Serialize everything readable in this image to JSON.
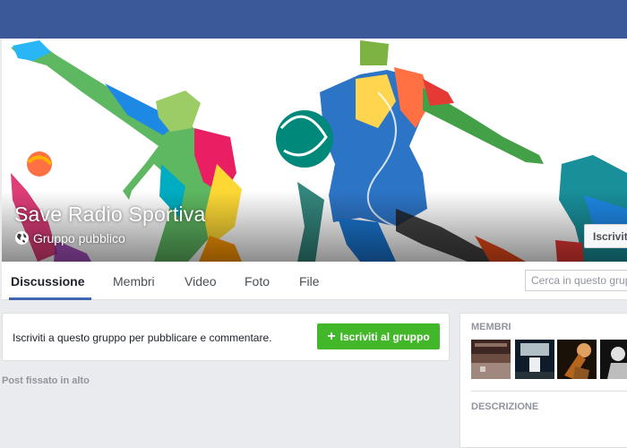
{
  "group": {
    "name": "Save Radio Sportiva",
    "privacy": "Gruppo pubblico",
    "cover_join_label": "Iscriviti"
  },
  "tabs": [
    {
      "label": "Discussione",
      "active": true
    },
    {
      "label": "Membri",
      "active": false
    },
    {
      "label": "Video",
      "active": false
    },
    {
      "label": "Foto",
      "active": false
    },
    {
      "label": "File",
      "active": false
    }
  ],
  "search": {
    "placeholder": "Cerca in questo gruppo"
  },
  "join_card": {
    "text": "Iscriviti a questo gruppo per pubblicare e commentare.",
    "button_label": "Iscriviti al gruppo",
    "button_icon": "plus-icon"
  },
  "pinned": {
    "label": "Post fissato in alto"
  },
  "sidebar": {
    "members_heading": "MEMBRI",
    "description_heading": "DESCRIZIONE"
  },
  "colors": {
    "topbar": "#3b5998",
    "join_button": "#42b72a",
    "active_tab_underline": "#4267b2"
  }
}
